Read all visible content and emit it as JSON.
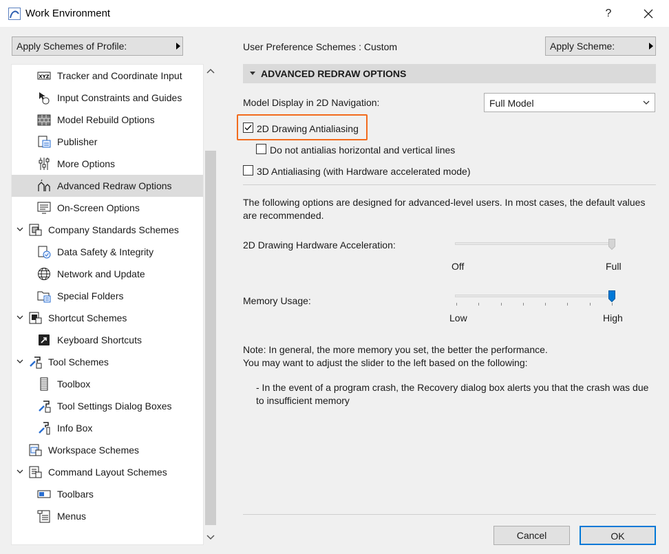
{
  "window": {
    "title": "Work Environment",
    "help": "?"
  },
  "left": {
    "profile_button": "Apply Schemes of Profile:"
  },
  "tree": [
    {
      "label": "Tracker and Coordinate Input",
      "icon": "xyz-icon",
      "level": 1
    },
    {
      "label": "Input Constraints and Guides",
      "icon": "mouse-pointer-icon",
      "level": 1
    },
    {
      "label": "Model Rebuild Options",
      "icon": "brick-wall-icon",
      "level": 1
    },
    {
      "label": "Publisher",
      "icon": "publisher-icon",
      "level": 1
    },
    {
      "label": "More Options",
      "icon": "sliders-icon",
      "level": 1
    },
    {
      "label": "Advanced Redraw Options",
      "icon": "redraw-icon",
      "level": 1,
      "selected": true
    },
    {
      "label": "On-Screen Options",
      "icon": "monitor-icon",
      "level": 1
    },
    {
      "label": "Company Standards Schemes",
      "icon": "company-schemes-icon",
      "level": 0,
      "expanded": true
    },
    {
      "label": "Data Safety & Integrity",
      "icon": "data-safety-icon",
      "level": 1
    },
    {
      "label": "Network and Update",
      "icon": "globe-icon",
      "level": 1
    },
    {
      "label": "Special Folders",
      "icon": "folder-icon",
      "level": 1
    },
    {
      "label": "Shortcut Schemes",
      "icon": "shortcut-schemes-icon",
      "level": 0,
      "expanded": true
    },
    {
      "label": "Keyboard Shortcuts",
      "icon": "keyboard-shortcut-icon",
      "level": 1
    },
    {
      "label": "Tool Schemes",
      "icon": "tool-schemes-icon",
      "level": 0,
      "expanded": true
    },
    {
      "label": "Toolbox",
      "icon": "toolbox-icon",
      "level": 1
    },
    {
      "label": "Tool Settings Dialog Boxes",
      "icon": "tool-settings-icon",
      "level": 1
    },
    {
      "label": "Info Box",
      "icon": "info-box-icon",
      "level": 1
    },
    {
      "label": "Workspace Schemes",
      "icon": "workspace-schemes-icon",
      "level": 0,
      "expanded": false
    },
    {
      "label": "Command Layout Schemes",
      "icon": "command-layout-icon",
      "level": 0,
      "expanded": true
    },
    {
      "label": "Toolbars",
      "icon": "toolbars-icon",
      "level": 1
    },
    {
      "label": "Menus",
      "icon": "menus-icon",
      "level": 1
    }
  ],
  "right": {
    "scheme_label": "User Preference Schemes :",
    "scheme_value": "Custom",
    "apply_scheme_button": "Apply Scheme:",
    "section_title": "ADVANCED REDRAW OPTIONS",
    "model_display_label": "Model Display in 2D Navigation:",
    "model_display_value": "Full Model",
    "checkbox_2d_aa": {
      "label": "2D Drawing Antialiasing",
      "checked": true
    },
    "checkbox_no_aa_lines": {
      "label": "Do not antialias horizontal and vertical lines",
      "checked": false
    },
    "checkbox_3d_aa": {
      "label": "3D Antialiasing (with Hardware accelerated mode)",
      "checked": false
    },
    "advanced_note": "The following options are designed for advanced-level users. In most cases, the default values are recommended.",
    "hw_accel": {
      "label": "2D Drawing Hardware Acceleration:",
      "min_label": "Off",
      "max_label": "Full",
      "value": 1.0,
      "enabled": false
    },
    "memory": {
      "label": "Memory Usage:",
      "min_label": "Low",
      "max_label": "High",
      "value": 1.0,
      "ticks": 8
    },
    "note_line1": "Note: In general, the more memory you set, the better the performance.",
    "note_line2": "You may want to adjust the slider to the left based on the following:",
    "note_bullet": "- In the event of a program crash, the Recovery dialog box alerts you that the crash was due to insufficient memory",
    "cancel": "Cancel",
    "ok": "OK"
  },
  "colors": {
    "highlight": "#f26b1d",
    "accent": "#0078d7",
    "selected_row": "#dcdcdc"
  }
}
